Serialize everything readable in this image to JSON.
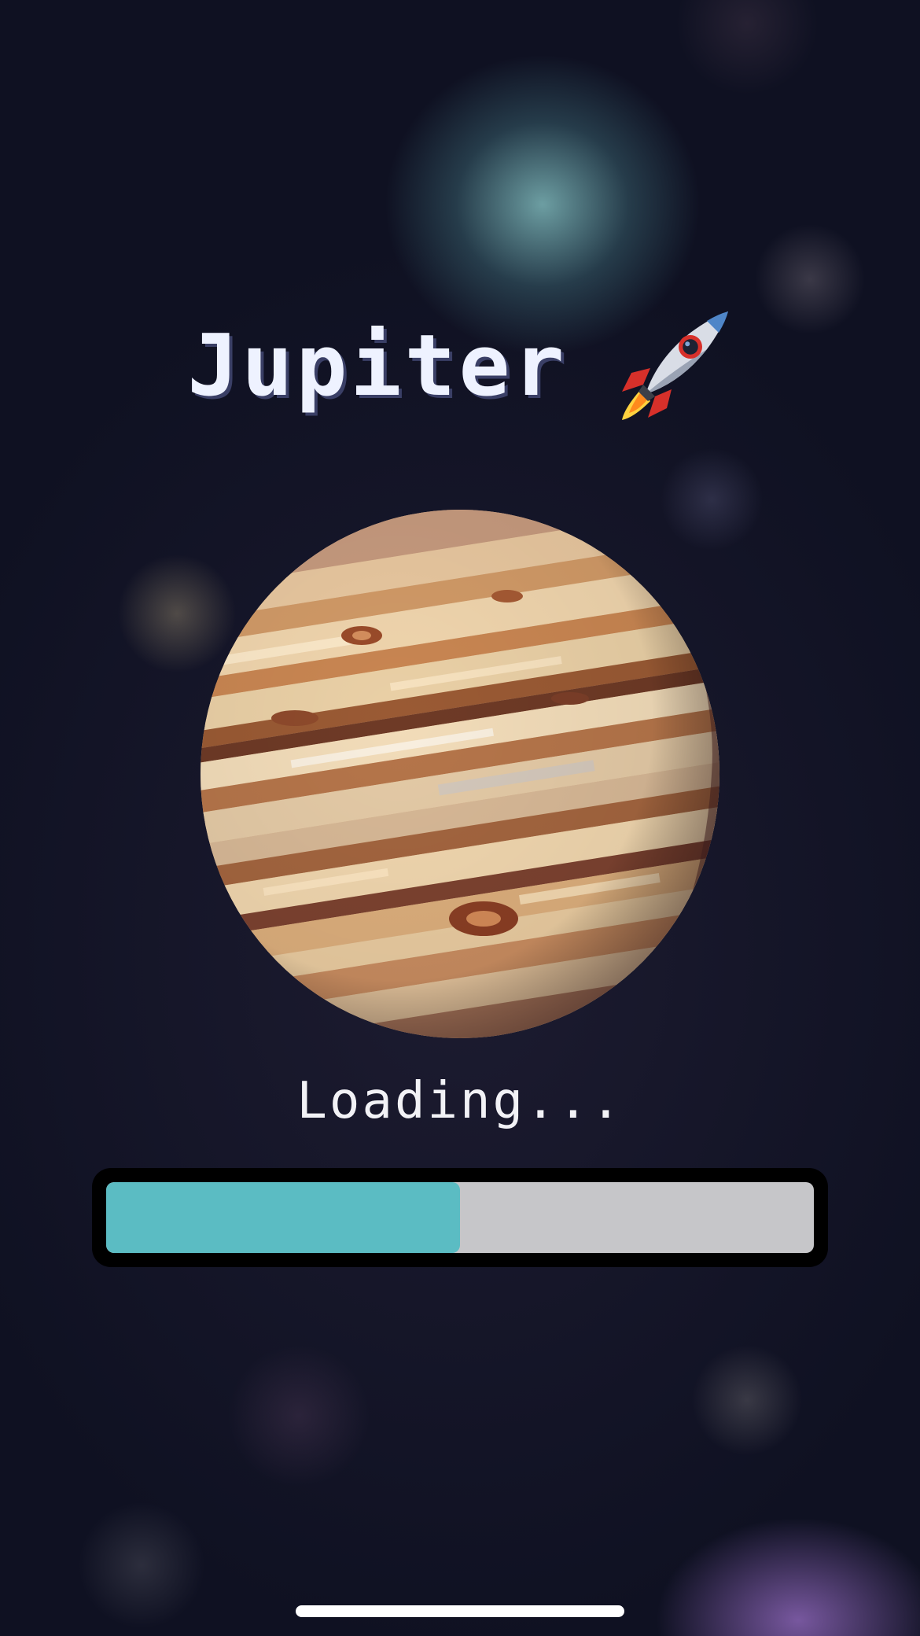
{
  "title": {
    "text": "Jupiter",
    "icon": "rocket-icon"
  },
  "planet": {
    "icon": "jupiter-planet-image",
    "colors": [
      "#e2bf93",
      "#c98a55",
      "#8b4a2c",
      "#f3dcb8",
      "#5a2e2a"
    ]
  },
  "loading": {
    "text": "Loading...",
    "progress": 0.5
  },
  "colors": {
    "progress_fill": "#5bbcc3",
    "progress_track": "#c6c6c9",
    "progress_frame": "#000000",
    "title_text": "#eef2ff",
    "background": "#0f1122"
  }
}
